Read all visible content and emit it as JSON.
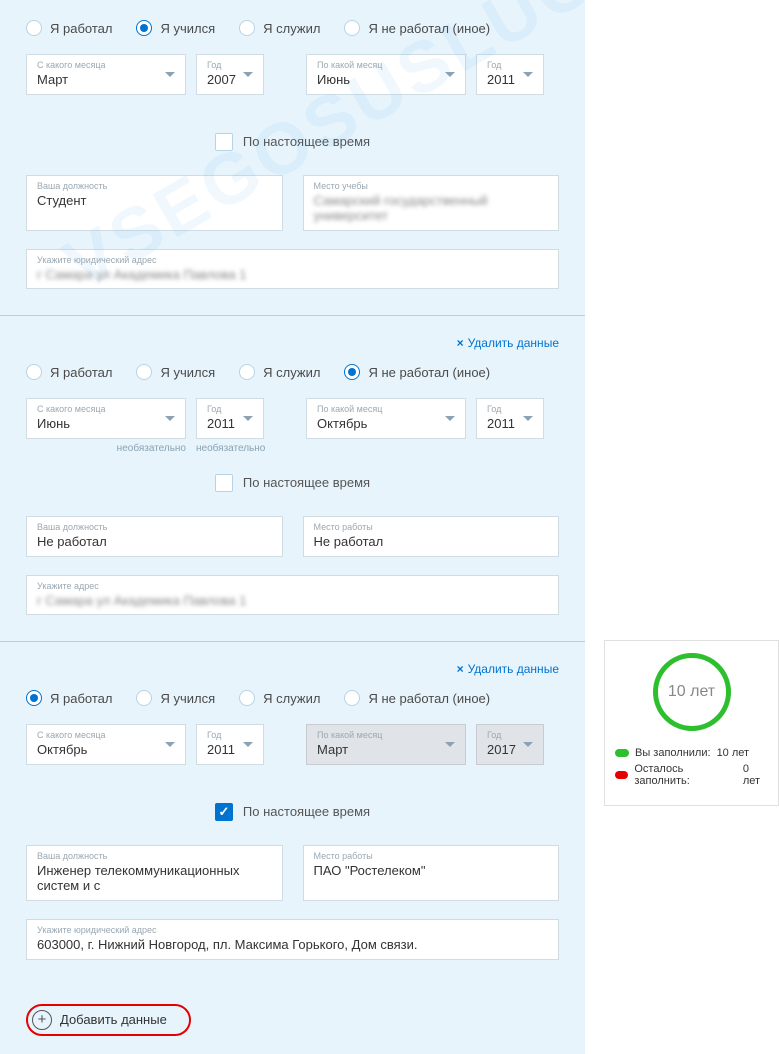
{
  "labels": {
    "worked": "Я работал",
    "studied": "Я учился",
    "served": "Я служил",
    "other": "Я не работал (иное)",
    "from_month": "С какого месяца",
    "year": "Год",
    "to_month": "По какой месяц",
    "optional": "необязательно",
    "present": "По настоящее время",
    "position": "Ваша должность",
    "study_place": "Место учебы",
    "work_place": "Место работы",
    "legal_address": "Укажите юридический адрес",
    "address": "Укажите адрес",
    "delete": "Удалить данные",
    "add": "Добавить данные"
  },
  "blocks": [
    {
      "type": "studied",
      "from_month": "Март",
      "from_year": "2007",
      "to_month": "Июнь",
      "to_year": "2011",
      "present": false,
      "show_delete": false,
      "position": "Студент",
      "place_label": "study_place",
      "place_value_blurred": true,
      "place_value": "Самарский государственный университет",
      "address_label": "legal_address",
      "address_blurred": true,
      "address_value": "г Самара ул Академика Павлова 1"
    },
    {
      "type": "other",
      "from_month": "Июнь",
      "from_year": "2011",
      "to_month": "Октябрь",
      "to_year": "2011",
      "present": false,
      "show_delete": true,
      "show_optional": true,
      "position": "Не работал",
      "place_label": "work_place",
      "place_value": "Не работал",
      "address_label": "address",
      "address_blurred": true,
      "address_value": "г Самара ул Академика Павлова 1"
    },
    {
      "type": "worked",
      "from_month": "Октябрь",
      "from_year": "2011",
      "to_month": "Март",
      "to_year": "2017",
      "to_disabled": true,
      "present": true,
      "show_delete": true,
      "position": "Инженер телекоммуникационных систем и с",
      "place_label": "work_place",
      "place_value": "ПАО \"Ростелеком\"",
      "address_label": "legal_address",
      "address_value": "603000, г. Нижний Новгород, пл. Максима Горького, Дом связи."
    }
  ],
  "side": {
    "ring_text": "10 лет",
    "filled_label": "Вы заполнили:",
    "filled_value": "10 лет",
    "remain_label": "Осталось заполнить:",
    "remain_value": "0 лет"
  },
  "watermark": "VSEGOSUSLUGI.RU"
}
